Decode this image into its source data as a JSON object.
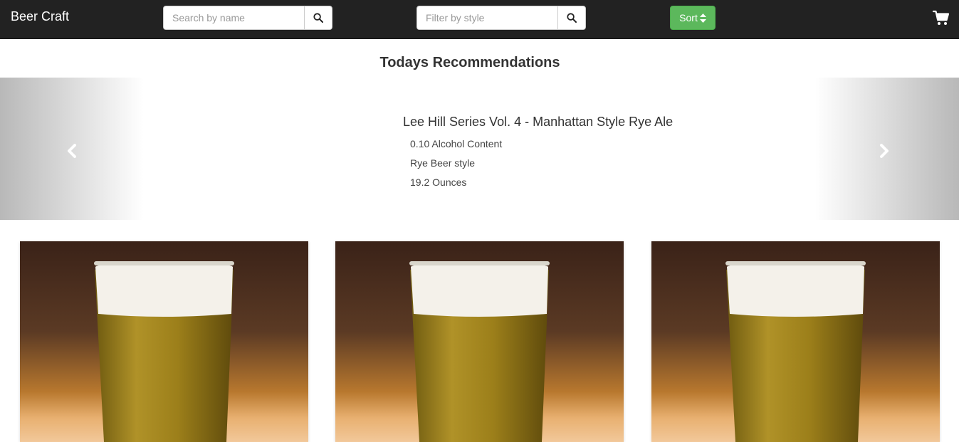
{
  "navbar": {
    "brand": "Beer Craft",
    "search_name": {
      "placeholder": "Search by name",
      "value": ""
    },
    "filter_style": {
      "placeholder": "Filter by style",
      "value": ""
    },
    "sort_label": "Sort",
    "icons": {
      "search": "search-icon",
      "sort": "sort-icon",
      "cart": "shopping-cart-icon"
    }
  },
  "recommendations": {
    "title": "Todays Recommendations",
    "slide": {
      "name": "Lee Hill Series Vol. 4 - Manhattan Style Rye Ale",
      "abv": "0.10 Alcohol Content",
      "style": "Rye Beer style",
      "ounces": "19.2 Ounces"
    },
    "controls": {
      "prev": "chevron-left-icon",
      "next": "chevron-right-icon"
    }
  },
  "cards": [
    {
      "image": "beer-glass-image"
    },
    {
      "image": "beer-glass-image"
    },
    {
      "image": "beer-glass-image"
    }
  ],
  "colors": {
    "navbar_bg": "#222222",
    "sort_button": "#5cb85c",
    "beer": "#a88a1a",
    "foam": "#f4f1ea"
  }
}
